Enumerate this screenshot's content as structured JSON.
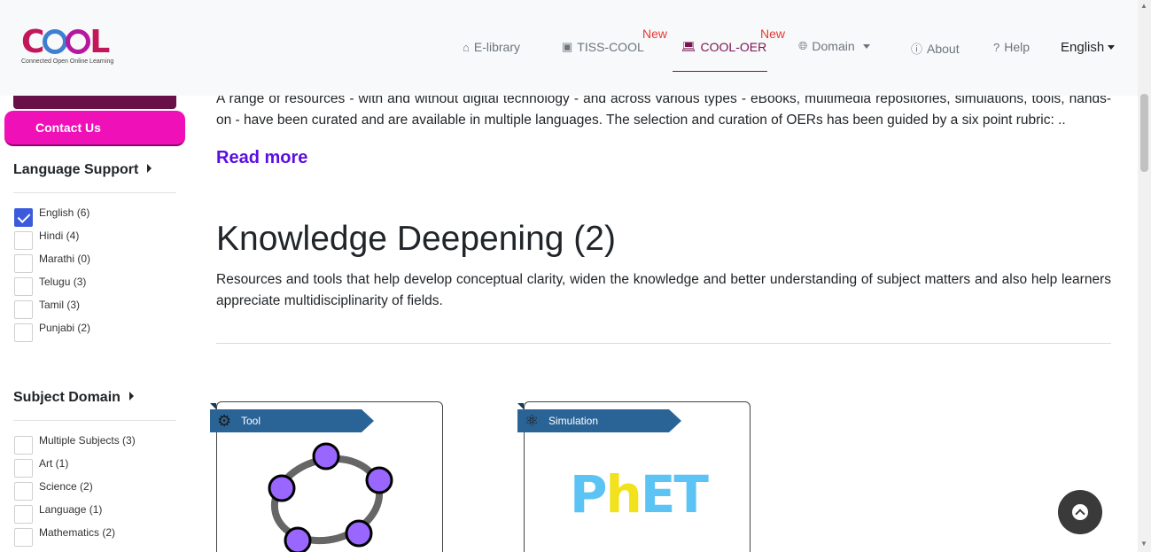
{
  "header": {
    "logo": {
      "text": "COOL",
      "subtitle": "Connected Open Online Learning"
    },
    "nav": [
      {
        "label": "E-library",
        "icon": "home-icon",
        "new": false
      },
      {
        "label": "TISS-COOL",
        "icon": "teacher-board-icon",
        "new": true
      },
      {
        "label": "COOL-OER",
        "icon": "laptop-icon",
        "new": true,
        "active": true
      },
      {
        "label": "Domain",
        "icon": "globe-icon",
        "dropdown": true
      },
      {
        "label": "About",
        "icon": "info-icon"
      },
      {
        "label": "Help",
        "icon": "question-circle-icon"
      }
    ],
    "new_badge": "New",
    "language": "English"
  },
  "sidebar": {
    "contact_label": "Contact Us",
    "language_title": "Language Support",
    "languages": [
      {
        "label": "English (6)",
        "checked": true
      },
      {
        "label": "Hindi (4)",
        "checked": false
      },
      {
        "label": "Marathi (0)",
        "checked": false
      },
      {
        "label": "Telugu (3)",
        "checked": false
      },
      {
        "label": "Tamil (3)",
        "checked": false
      },
      {
        "label": "Punjabi (2)",
        "checked": false
      }
    ],
    "subject_title": "Subject Domain",
    "subjects": [
      {
        "label": "Multiple Subjects (3)",
        "checked": false
      },
      {
        "label": "Art (1)",
        "checked": false
      },
      {
        "label": "Science (2)",
        "checked": false
      },
      {
        "label": "Language (1)",
        "checked": false
      },
      {
        "label": "Mathematics (2)",
        "checked": false
      }
    ]
  },
  "main": {
    "intro": "A range of resources - with and without digital technology - and across various types - eBooks, multimedia repositories, simulations, tools, hands-on - have been curated and are available in multiple languages. The selection and curation of OERs has been guided by a six point rubric: ..",
    "read_more": "Read more",
    "section_title": "Knowledge Deepening (2)",
    "section_desc": "Resources and tools that help develop conceptual clarity, widen the knowledge and better understanding of subject matters and also help learners appreciate multidisciplinarity of fields.",
    "cards": [
      {
        "ribbon": "Tool",
        "ribbon_icon": "gears-icon",
        "image": "geogebra-logo"
      },
      {
        "ribbon": "Simulation",
        "ribbon_icon": "atom-icon",
        "image": "phet-logo",
        "logo_text": "PhET"
      }
    ]
  },
  "colors": {
    "accent": "#7b1450",
    "contact": "#f010b8",
    "ribbon": "#2a6496",
    "link": "#5b0fe0",
    "new": "#e53935"
  }
}
